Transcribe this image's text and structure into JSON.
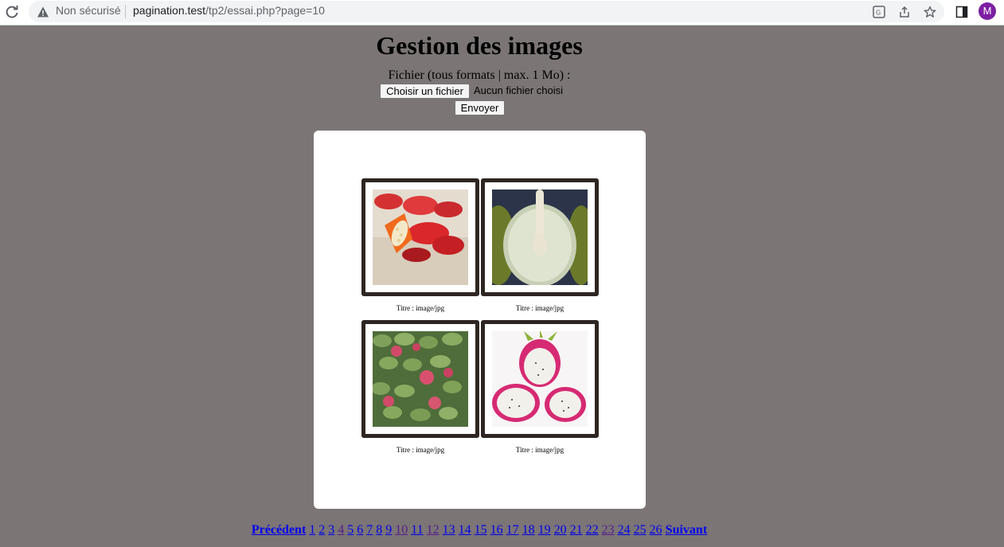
{
  "browser": {
    "security_label": "Non sécurisé",
    "url_host": "pagination.test",
    "url_path": "/tp2/essai.php?page=10",
    "avatar_letter": "M"
  },
  "page": {
    "title": "Gestion des images",
    "file_label": "Fichier (tous formats | max. 1 Mo) :",
    "choose_file_label": "Choisir un fichier",
    "no_file_label": "Aucun fichier choisi",
    "submit_label": "Envoyer"
  },
  "gallery": [
    {
      "caption": "Titre : image/jpg",
      "image": "rose-hips-photo"
    },
    {
      "caption": "Titre : image/jpg",
      "image": "breadfruit-photo"
    },
    {
      "caption": "Titre : image/jpg",
      "image": "green-pods-photo"
    },
    {
      "caption": "Titre : image/jpg",
      "image": "dragon-fruit-photo"
    }
  ],
  "pagination": {
    "prev_label": "Précédent",
    "next_label": "Suivant",
    "pages": [
      "1",
      "2",
      "3",
      "4",
      "5",
      "6",
      "7",
      "8",
      "9",
      "10",
      "11",
      "12",
      "13",
      "14",
      "15",
      "16",
      "17",
      "18",
      "19",
      "20",
      "21",
      "22",
      "23",
      "24",
      "25",
      "26"
    ],
    "visited_pages": [
      "4",
      "10",
      "12",
      "23"
    ],
    "current_page": "10"
  },
  "colors": {
    "page_background": "#7b7575",
    "panel_background": "#ffffff",
    "frame_border": "#2e2622",
    "link": "#0000ee",
    "visited_link": "#551a8b"
  }
}
